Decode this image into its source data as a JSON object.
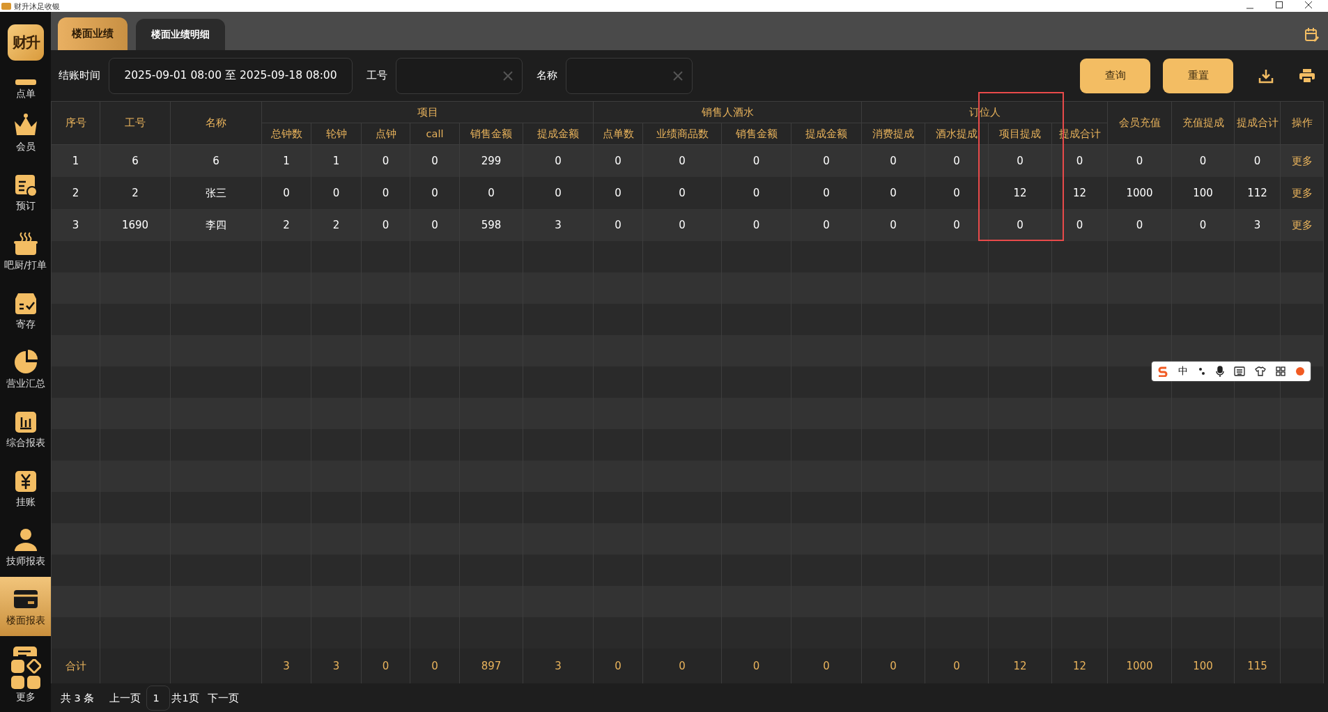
{
  "window": {
    "title": "财升沐足收银"
  },
  "sidebar": {
    "logo": "财升",
    "items": [
      {
        "label": "点单",
        "selected": false
      },
      {
        "label": "会员",
        "selected": false
      },
      {
        "label": "预订",
        "selected": false
      },
      {
        "label": "吧厨/打单",
        "selected": false
      },
      {
        "label": "寄存",
        "selected": false
      },
      {
        "label": "营业汇总",
        "selected": false
      },
      {
        "label": "综合报表",
        "selected": false
      },
      {
        "label": "挂账",
        "selected": false
      },
      {
        "label": "技师报表",
        "selected": false
      },
      {
        "label": "楼面报表",
        "selected": true
      }
    ],
    "more": "更多"
  },
  "tabs": [
    {
      "label": "楼面业绩",
      "selected": true
    },
    {
      "label": "楼面业绩明细",
      "selected": false
    }
  ],
  "filters": {
    "date_label": "结账时间",
    "date_value": "2025-09-01 08:00 至 2025-09-18 08:00",
    "id_label": "工号",
    "name_label": "名称",
    "buttons": [
      "查询",
      "重置"
    ]
  },
  "table": {
    "columns": [
      {
        "label": "序号"
      },
      {
        "label": "工号"
      },
      {
        "label": "名称"
      },
      {
        "label": "项目",
        "colspan": 6,
        "children": [
          "总钟数",
          "轮钟",
          "点钟",
          "call",
          "销售金额",
          "提成金额"
        ]
      },
      {
        "label": "销售人酒水",
        "colspan": 4,
        "children": [
          "点单数",
          "业绩商品数",
          "销售金额",
          "提成金额"
        ]
      },
      {
        "label": "订位人",
        "colspan": 4,
        "children": [
          "消费提成",
          "酒水提成",
          "项目提成",
          "提成合计"
        ]
      },
      {
        "label": "会员充值"
      },
      {
        "label": "充值提成"
      },
      {
        "label": "提成合计"
      },
      {
        "label": "操作"
      }
    ],
    "rows": [
      {
        "cells": [
          "1",
          "6",
          "6",
          "1",
          "1",
          "0",
          "0",
          "299",
          "0",
          "0",
          "0",
          "0",
          "0",
          "0",
          "0",
          "0",
          "0",
          "0",
          "0",
          "0"
        ],
        "action": "更多"
      },
      {
        "cells": [
          "2",
          "2",
          "张三",
          "0",
          "0",
          "0",
          "0",
          "0",
          "0",
          "0",
          "0",
          "0",
          "0",
          "0",
          "0",
          "12",
          "12",
          "1000",
          "100",
          "112"
        ],
        "action": "更多"
      },
      {
        "cells": [
          "3",
          "1690",
          "李四",
          "2",
          "2",
          "0",
          "0",
          "598",
          "3",
          "0",
          "0",
          "0",
          "0",
          "0",
          "0",
          "0",
          "0",
          "0",
          "0",
          "3"
        ],
        "action": "更多"
      }
    ],
    "totals": {
      "label": "合计",
      "values": [
        "3",
        "3",
        "0",
        "0",
        "897",
        "3",
        "0",
        "0",
        "0",
        "0",
        "0",
        "0",
        "12",
        "12",
        "1000",
        "100",
        "115"
      ]
    }
  },
  "pagination": {
    "count": "共 3 条",
    "prev": "上一页",
    "page": "1",
    "pages": "共1页",
    "next": "下一页"
  },
  "ime_toolbar": {
    "mode": "中"
  }
}
